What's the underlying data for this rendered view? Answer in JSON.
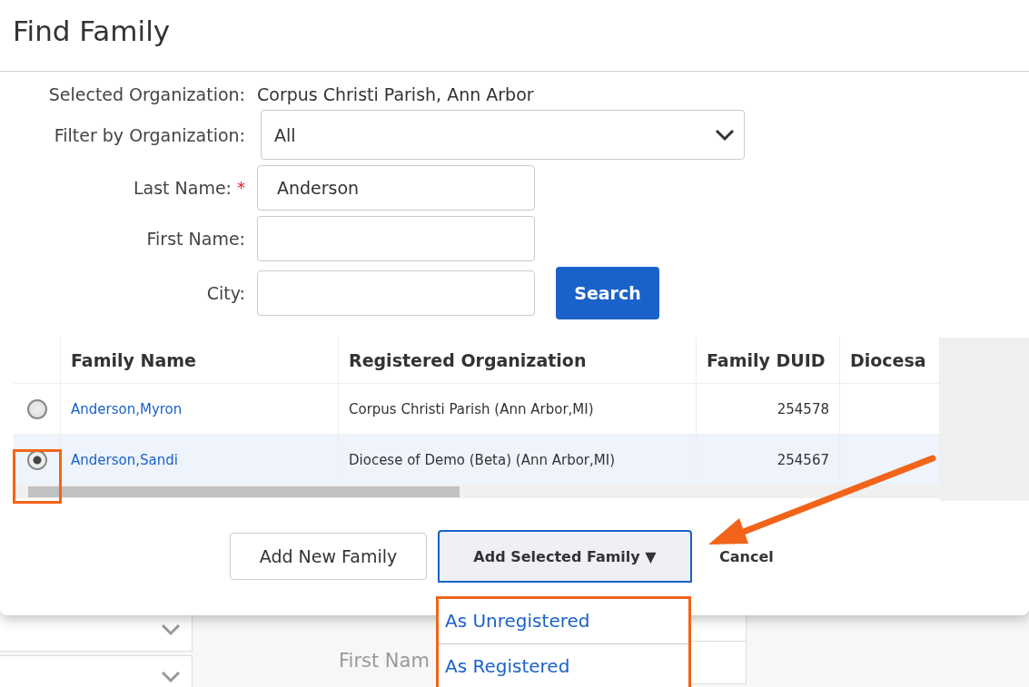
{
  "dialog": {
    "title": "Find Family",
    "selected_organization": {
      "label": "Selected Organization:",
      "value": "Corpus Christi Parish, Ann Arbor"
    },
    "fields": [
      {
        "kind": "select",
        "label": "Filter by Organization:",
        "value": "All"
      },
      {
        "kind": "text",
        "label": "Last Name:",
        "value": "Anderson",
        "required": true
      },
      {
        "kind": "text",
        "label": "First Name:"
      },
      {
        "kind": "text",
        "label": "City:"
      }
    ],
    "required_mark": "*",
    "search_button": "Search",
    "table": {
      "columns": [
        "Family Name",
        "Registered Organization",
        "Family DUID",
        "Diocesa"
      ],
      "rows": [
        {
          "selected": false,
          "family_name": "Anderson,Myron",
          "organization": "Corpus Christi Parish (Ann Arbor,MI)",
          "duid": "254578"
        },
        {
          "selected": true,
          "family_name": "Anderson,Sandi",
          "organization": "Diocese of Demo (Beta) (Ann Arbor,MI)",
          "duid": "254567"
        }
      ]
    },
    "buttons": {
      "add_new": "Add New Family",
      "add_selected": "Add Selected Family",
      "caret": "▼",
      "cancel": "Cancel"
    },
    "menu": {
      "items": [
        "As Unregistered",
        "As Registered"
      ]
    }
  },
  "background": {
    "label": "First Nam"
  }
}
